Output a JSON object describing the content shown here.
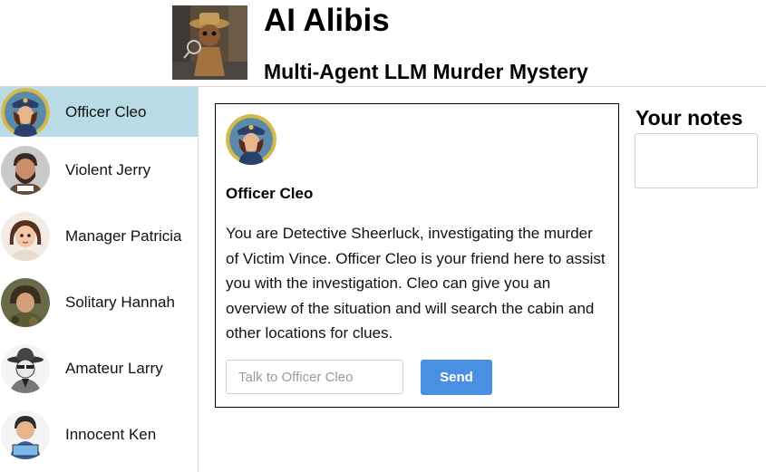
{
  "header": {
    "title": "AI Alibis",
    "subtitle": "Multi-Agent LLM Murder Mystery",
    "logo_icon": "detective-figure-logo"
  },
  "sidebar": {
    "items": [
      {
        "label": "Officer Cleo",
        "selected": true,
        "avatar_icon": "police-officer-avatar"
      },
      {
        "label": "Violent Jerry",
        "selected": false,
        "avatar_icon": "bearded-man-avatar"
      },
      {
        "label": "Manager Patricia",
        "selected": false,
        "avatar_icon": "woman-avatar"
      },
      {
        "label": "Solitary Hannah",
        "selected": false,
        "avatar_icon": "camouflage-woman-avatar"
      },
      {
        "label": "Amateur Larry",
        "selected": false,
        "avatar_icon": "fedora-detective-avatar"
      },
      {
        "label": "Innocent Ken",
        "selected": false,
        "avatar_icon": "boy-with-sign-avatar"
      }
    ]
  },
  "chat": {
    "name": "Officer Cleo",
    "message": "You are Detective Sheerluck, investigating the murder of Victim Vince. Officer Cleo is your friend here to assist you with the investigation. Cleo can give you an overview of the situation and will search the cabin and other locations for clues.",
    "input_placeholder": "Talk to Officer Cleo",
    "input_value": "",
    "send_label": "Send"
  },
  "notes": {
    "title": "Your notes",
    "value": ""
  },
  "colors": {
    "selected_bg": "#b9dbe6",
    "send_button": "#4a90e2",
    "divider": "#d9d9d9"
  }
}
